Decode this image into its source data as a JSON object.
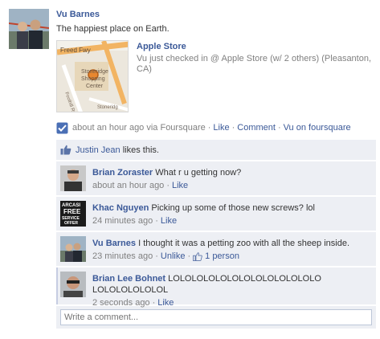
{
  "post": {
    "author": "Vu Barnes",
    "message": "The happiest place on Earth."
  },
  "place": {
    "name": "Apple Store",
    "checkin_text": "Vu just checked in @ Apple Store (w/ 2 others) (Pleasanton, CA)",
    "map_labels": {
      "road1": "Freed Fwy",
      "center_line1": "Stoneridge",
      "center_line2": "Shopping",
      "center_line3": "Center",
      "road2": "Foothill Rd",
      "road3": "Stoneridg"
    }
  },
  "meta": {
    "time": "about an hour ago via Foursquare",
    "like": "Like",
    "comment": "Comment",
    "app_link": "Vu on foursquare"
  },
  "likes": {
    "liker": "Justin Jean",
    "suffix": "likes this."
  },
  "comments": [
    {
      "author": "Brian Zoraster",
      "text": "What r u getting now?",
      "time": "about an hour ago",
      "action": "Like"
    },
    {
      "author": "Khac Nguyen",
      "text": "Picking up some of those new screws? lol",
      "time": "24 minutes ago",
      "action": "Like",
      "avatar_text": [
        "ARCASI",
        "FREE",
        "SERVICE",
        "OFFER"
      ]
    },
    {
      "author": "Vu Barnes",
      "text": "I thought it was a petting zoo with all the sheep inside.",
      "time": "23 minutes ago",
      "action": "Unlike",
      "likes": "1 person"
    },
    {
      "author": "Brian Lee Bohnet",
      "text": "LOLOLOLOLOLOLOLOLOLOLOLOLO LOLOLOLOLOLOL",
      "time": "2 seconds ago",
      "action": "Like"
    }
  ],
  "composer": {
    "placeholder": "Write a comment..."
  },
  "colors": {
    "link": "#3b5998",
    "feedback_bg": "#edeff4",
    "muted": "#808080"
  }
}
